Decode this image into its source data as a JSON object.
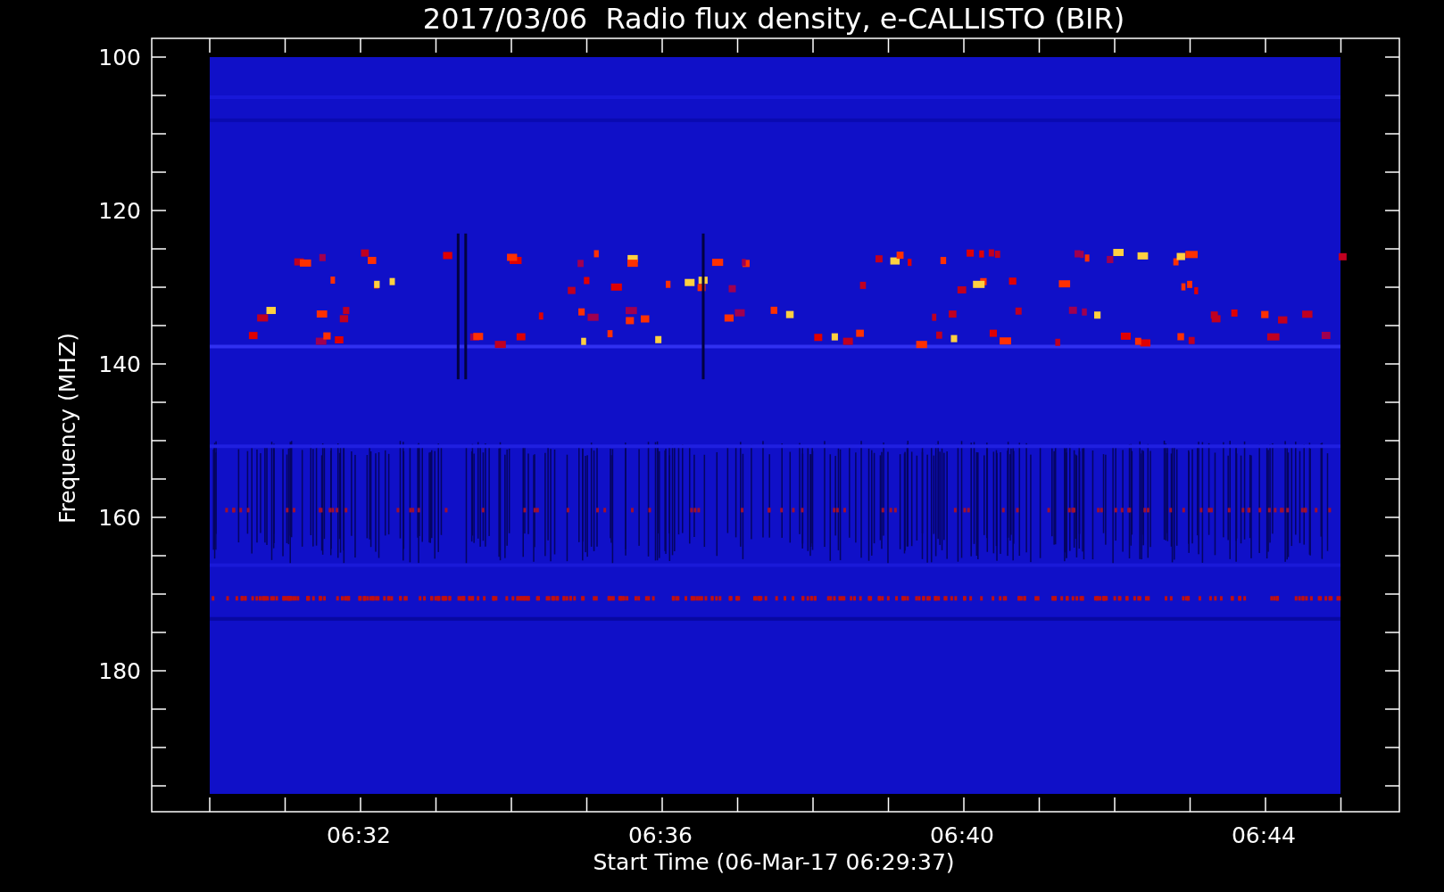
{
  "plot": {
    "title": "2017/03/06  Radio flux density, e-CALLISTO (BIR)",
    "ylabel": "Frequency (MHZ)",
    "xlabel": "Start Time (06-Mar-17 06:29:37)",
    "y_tick_labels": [
      "100",
      "120",
      "140",
      "160",
      "180"
    ],
    "x_tick_labels": [
      "06:32",
      "06:36",
      "06:40",
      "06:44"
    ]
  }
}
